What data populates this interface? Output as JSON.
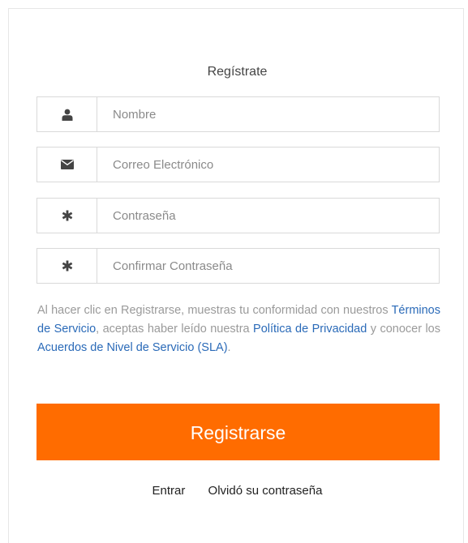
{
  "form": {
    "title": "Regístrate",
    "fields": [
      {
        "icon": "user-icon",
        "placeholder": "Nombre",
        "value": ""
      },
      {
        "icon": "envelope-icon",
        "placeholder": "Correo Electrónico",
        "value": ""
      },
      {
        "icon": "asterisk-icon",
        "placeholder": "Contraseña",
        "value": ""
      },
      {
        "icon": "asterisk-icon",
        "placeholder": "Confirmar Contraseña",
        "value": ""
      }
    ],
    "terms": {
      "text_1": "Al hacer clic en Registrarse, muestras tu conformidad con nuestros ",
      "link_terms": "Términos de Servicio",
      "text_2": ", aceptas haber leído nuestra ",
      "link_privacy": "Política de Privacidad",
      "text_3": " y conocer los ",
      "link_sla": "Acuerdos de Nivel de Servicio (SLA)",
      "text_4": "."
    },
    "submit_label": "Registrarse"
  },
  "footer": {
    "login_link": "Entrar",
    "forgot_link": "Olvidó su contraseña"
  },
  "colors": {
    "accent": "#ff6c00",
    "link": "#2a6ab8",
    "muted_text": "#9a9a9a"
  }
}
